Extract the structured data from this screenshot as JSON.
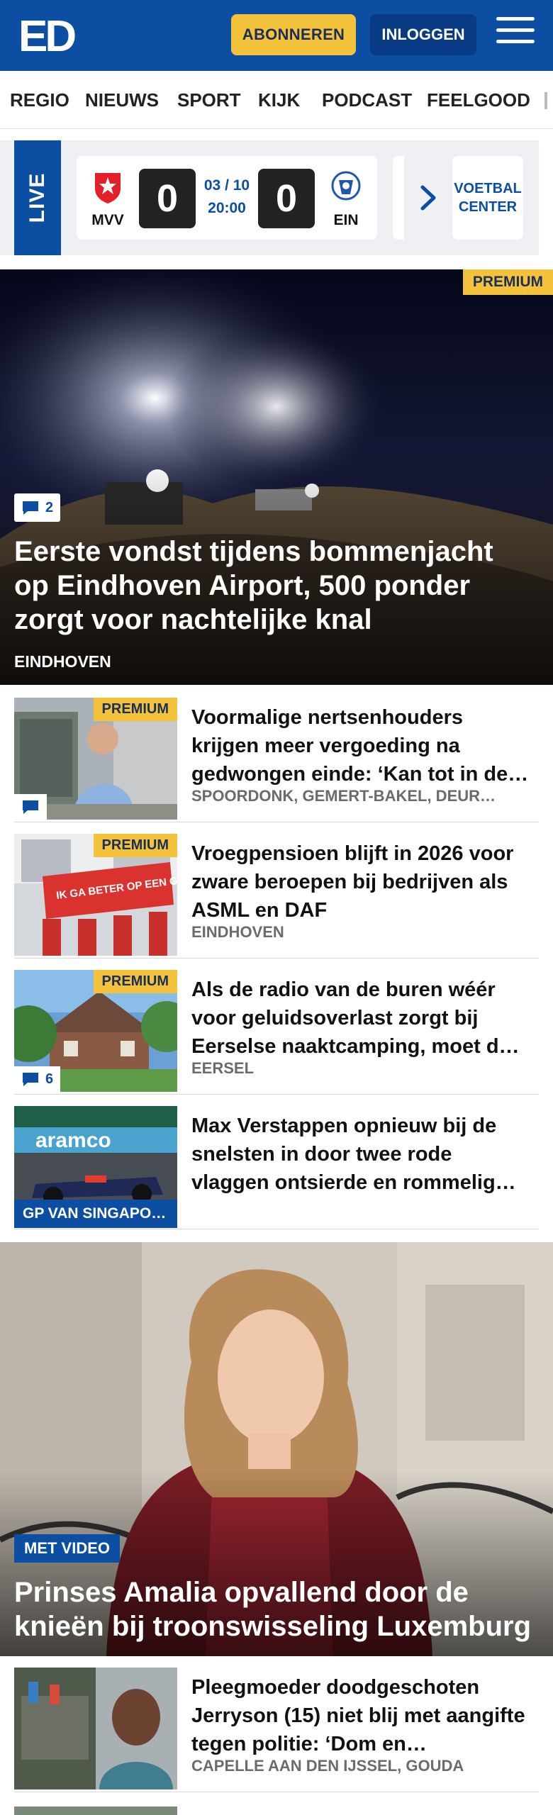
{
  "header": {
    "logo_text": "ED",
    "subscribe_label": "ABONNEREN",
    "login_label": "INLOGGEN"
  },
  "nav": {
    "items": [
      "REGIO",
      "NIEUWS",
      "SPORT",
      "KIJK",
      "PODCAST",
      "FEELGOOD"
    ]
  },
  "live": {
    "label": "LIVE",
    "match": {
      "home": "MVV",
      "away": "EIN",
      "home_score": "0",
      "away_score": "0",
      "date": "03 / 10",
      "time": "20:00"
    },
    "voetbal_center_label": "VOETBAL CENTER"
  },
  "hero": {
    "premium_label": "PREMIUM",
    "comments": "2",
    "title": "Eerste vondst tijdens bommenjacht op Eindhoven Airport, 500 ponder zorgt voor nachtelijke knal",
    "location": "EINDHOVEN"
  },
  "articles": [
    {
      "title": "Voormalige nertsenhouders krijgen meer vergoeding na gedwongen einde: ‘Kan tot in de…",
      "location": "SPOORDONK, GEMERT-BAKEL, DEUR…",
      "premium_label": "PREMIUM",
      "comments": ""
    },
    {
      "title": "Vroegpensioen blijft in 2026 voor zware beroepen bij bedrijven als ASML en DAF",
      "location": "EINDHOVEN",
      "premium_label": "PREMIUM",
      "sign_text": "IK GA BETER OP EEN GOEDE"
    },
    {
      "title": "Als de radio van de buren wéér voor geluidsoverlast zorgt bij Eerselse naaktcamping, moet d…",
      "location": "EERSEL",
      "premium_label": "PREMIUM",
      "comments": "6"
    },
    {
      "title": "Max Verstappen opnieuw bij de snelsten in door twee rode vlaggen ontsierde en rommelig…",
      "section": "GP VAN SINGAPO…",
      "banner_text": "aramco"
    }
  ],
  "feature": {
    "video_label": "MET VIDEO",
    "title": "Prinses Amalia opvallend door de knieën bij troonswisseling Luxemburg"
  },
  "article_bottom": {
    "title": "Pleegmoeder doodgeschoten Jerryson (15) niet blij met aangifte tegen politie: ‘Dom en…",
    "location": "CAPELLE AAN DEN IJSSEL, GOUDA"
  },
  "colors": {
    "brand_blue": "#0b4ea2",
    "premium_yellow": "#f5c33b"
  }
}
